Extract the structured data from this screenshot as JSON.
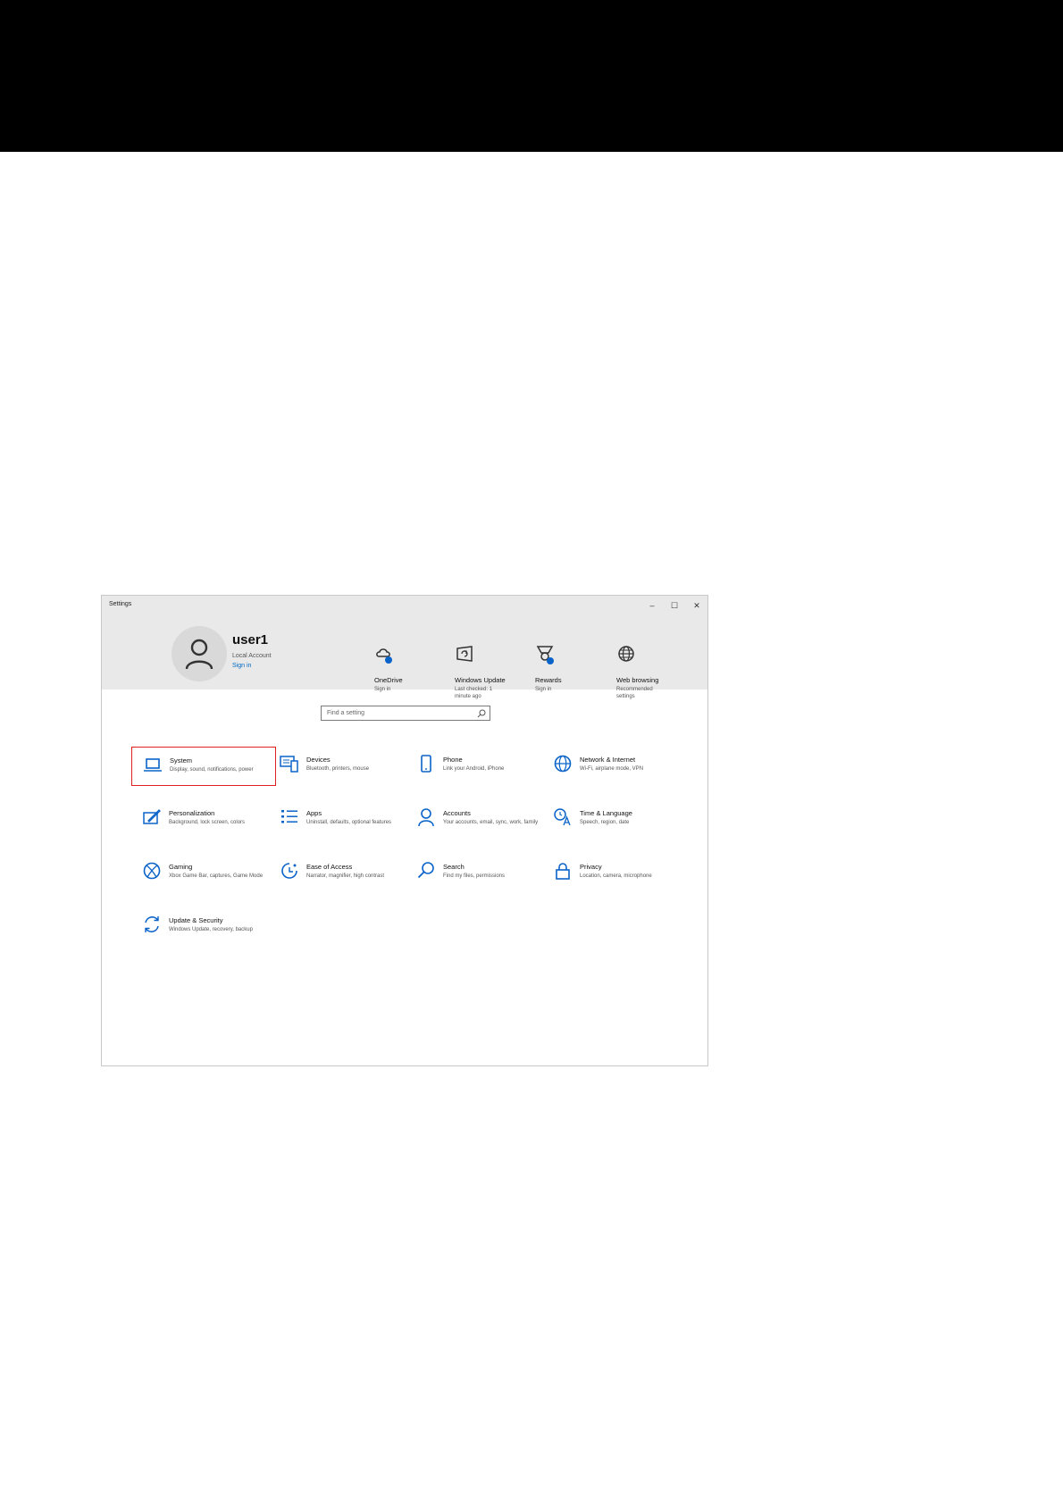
{
  "window": {
    "title": "Settings",
    "controls": {
      "minimize": "–",
      "maximize": "☐",
      "close": "✕"
    }
  },
  "account": {
    "name": "user1",
    "type": "Local Account",
    "action": "Sign in"
  },
  "quick_links": [
    {
      "title": "OneDrive",
      "subtitle": "Sign in",
      "icon": "cloud-icon"
    },
    {
      "title": "Windows Update",
      "subtitle": "Last checked: 1 minute ago",
      "icon": "update-icon"
    },
    {
      "title": "Rewards",
      "subtitle": "Sign in",
      "icon": "rewards-icon"
    },
    {
      "title": "Web browsing",
      "subtitle": "Recommended settings",
      "icon": "globe-icon"
    }
  ],
  "search": {
    "placeholder": "Find a setting",
    "icon": "search-icon"
  },
  "categories": [
    {
      "name": "System",
      "description": "Display, sound, notifications, power",
      "icon": "laptop-icon",
      "selected": true
    },
    {
      "name": "Devices",
      "description": "Bluetooth, printers, mouse",
      "icon": "keyboard-icon"
    },
    {
      "name": "Phone",
      "description": "Link your Android, iPhone",
      "icon": "phone-icon"
    },
    {
      "name": "Network & Internet",
      "description": "Wi-Fi, airplane mode, VPN",
      "icon": "globe-icon"
    },
    {
      "name": "Personalization",
      "description": "Background, lock screen, colors",
      "icon": "paintbrush-icon"
    },
    {
      "name": "Apps",
      "description": "Uninstall, defaults, optional features",
      "icon": "list-icon"
    },
    {
      "name": "Accounts",
      "description": "Your accounts, email, sync, work, family",
      "icon": "person-icon"
    },
    {
      "name": "Time & Language",
      "description": "Speech, region, date",
      "icon": "language-icon"
    },
    {
      "name": "Gaming",
      "description": "Xbox Game Bar, captures, Game Mode",
      "icon": "xbox-icon"
    },
    {
      "name": "Ease of Access",
      "description": "Narrator, magnifier, high contrast",
      "icon": "ease-of-access-icon"
    },
    {
      "name": "Search",
      "description": "Find my files, permissions",
      "icon": "search-icon"
    },
    {
      "name": "Privacy",
      "description": "Location, camera, microphone",
      "icon": "lock-icon"
    },
    {
      "name": "Update & Security",
      "description": "Windows Update, recovery, backup",
      "icon": "refresh-icon"
    }
  ],
  "colors": {
    "accent": "#0a63c9",
    "selection": "#e02020",
    "header_bg": "#e9e9e9"
  }
}
